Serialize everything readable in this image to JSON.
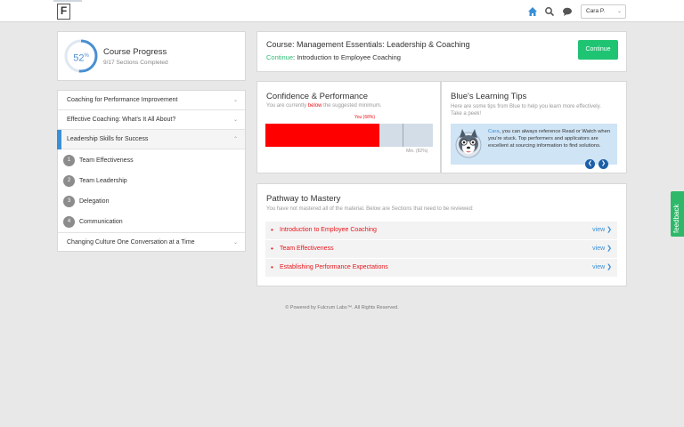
{
  "header": {
    "logo_letter": "F",
    "icons": [
      "home-icon",
      "search-icon",
      "chat-icon"
    ],
    "user_name": "Cara P.",
    "accent": "#3a8fd6"
  },
  "progress": {
    "percent_value": 0.52,
    "percent_num": "52",
    "percent_sign": "%",
    "title": "Course Progress",
    "subtitle": "9/17 Sections Completed"
  },
  "sections": {
    "items": [
      {
        "label": "Coaching for Performance Improvement"
      },
      {
        "label": "Effective Coaching: What's It All About?"
      },
      {
        "label": "Leadership Skills for Success"
      }
    ],
    "subitems": [
      {
        "num": "1",
        "label": "Team Effectiveness"
      },
      {
        "num": "2",
        "label": "Team Leadership"
      },
      {
        "num": "3",
        "label": "Delegation"
      },
      {
        "num": "4",
        "label": "Communication"
      }
    ],
    "last": {
      "label": "Changing Culture One Conversation at a Time"
    }
  },
  "course": {
    "label": "Course:",
    "name": "Management Essentials: Leadership & Coaching",
    "continue_link": "Continue",
    "continue_text": ": Introduction to Employee Coaching",
    "button": "Continue"
  },
  "confidence": {
    "title": "Confidence & Performance",
    "sub_before": "You are currently ",
    "sub_below": "below",
    "sub_after": " the suggested minimum.",
    "you_label": "You (68%)",
    "min_label": "Min. (82%)",
    "you_value": 0.68,
    "min_value": 0.82
  },
  "tips": {
    "title": "Blue's Learning Tips",
    "subtitle": "Here are some tips from Blue to help you learn more effectively. Take a peek!",
    "name": "Cara",
    "text": ", you can always reference Read or Watch when you're stuck. Top performers and applicators are excellent at sourcing information to find solutions."
  },
  "pathway": {
    "title": "Pathway to Mastery",
    "subtitle": "You have not mastered all of the material. Below are Sections that need to be reviewed:",
    "rows": [
      {
        "label": "Introduction to Employee Coaching",
        "action": "view"
      },
      {
        "label": "Team Effectiveness",
        "action": "view"
      },
      {
        "label": "Establishing Performance Expectations",
        "action": "view"
      }
    ]
  },
  "footer": "© Powered by Fulcrum Labs™. All Rights Reserved.",
  "feedback": "feedback"
}
